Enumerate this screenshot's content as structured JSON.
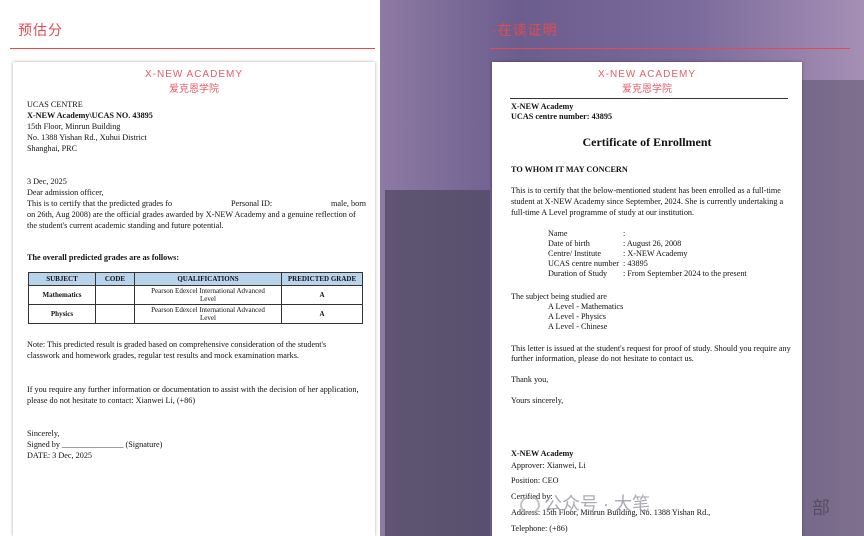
{
  "sections": {
    "left_title": "预估分",
    "right_title": "·在读证明"
  },
  "academy": {
    "name_en": "X-NEW ACADEMY",
    "name_zh": "爱克恩学院"
  },
  "predicted_letter": {
    "addr_lines": [
      "UCAS CENTRE",
      "X-NEW Academy\\UCAS NO. 43895",
      "15th Floor, Minrun Building",
      "No. 1388 Yishan Rd., Xuhui District",
      "Shanghai, PRC"
    ],
    "date": "3 Dec, 2025",
    "salutation": "Dear admission officer,",
    "body_1a": "This is to certify that the predicted grades fo",
    "body_1b": "Personal ID:",
    "body_1c": "male, born",
    "body_2": "on 26th, Aug 2008) are the official grades awarded by X-NEW Academy and a genuine reflection of",
    "body_3": "the student's current academic standing and future potential.",
    "table_heading": "The overall predicted grades are as follows:",
    "table_headers": [
      "SUBJECT",
      "CODE",
      "QUALIFICATIONS",
      "PREDICTED GRADE"
    ],
    "rows": [
      {
        "subject": "Mathematics",
        "code": "",
        "qual_1": "Pearson Edexcel International Advanced",
        "qual_2": "Level",
        "grade": "A"
      },
      {
        "subject": "Physics",
        "code": "",
        "qual_1": "Pearson Edexcel International Advanced",
        "qual_2": "Level",
        "grade": "A"
      }
    ],
    "note_1": "Note: This predicted result is graded based on comprehensive consideration of the student's",
    "note_2": "classwork and homework grades, regular test results and mock examination marks.",
    "info_1": "If you require any further information or documentation to assist with the decision of her application,",
    "info_2": "please do not hesitate to contact: Xianwei Li, (+86)",
    "closing": "Sincerely,",
    "signed": "Signed by _______________ (Signature)",
    "date_line": "DATE: 3 Dec, 2025"
  },
  "enrollment": {
    "org": "X-NEW Academy",
    "ucas": "UCAS centre number: 43895",
    "title": "Certificate of Enrollment",
    "to_whom": "TO WHOM IT MAY CONCERN",
    "intro_1": "This is to certify that the below-mentioned student has been enrolled as a full-time",
    "intro_2": "student at X-NEW Academy since September, 2024. She is currently undertaking a",
    "intro_3": "full-time A Level programme of study at our institution.",
    "fields": [
      {
        "label": "Name",
        "value": ":"
      },
      {
        "label": "Date of birth",
        "value": ":  August 26, 2008"
      },
      {
        "label": "Centre/ Institute",
        "value": ": X-NEW Academy"
      },
      {
        "label": "UCAS centre number",
        "value": ": 43895"
      },
      {
        "label": "Duration of Study",
        "value": ": From September 2024 to the present"
      }
    ],
    "subjects_heading": "The subject being studied are",
    "subjects": [
      "A Level - Mathematics",
      "A Level - Physics",
      "A Level - Chinese"
    ],
    "closing_1": "This letter is issued at the student's request for proof of study. Should you require any",
    "closing_2": "further information, please do not hesitate to contact us.",
    "thanks": "Thank you,",
    "yours": "Yours sincerely,",
    "sig_org": "X-NEW Academy",
    "approver": "Approver: Xianwei, Li",
    "position": "Position: CEO",
    "certified": "Certified by:",
    "address": "Address: 15th Floor, Minrun Building, No. 1388 Yishan Rd.,",
    "telephone": "Telephone: (+86)"
  },
  "watermark": {
    "line1": "公众号 · 大笔",
    "line2": "部"
  },
  "colors": {
    "accent_red": "#e54a4f",
    "header_pink": "#e35d6a",
    "table_header_blue": "#b9d4ea"
  }
}
